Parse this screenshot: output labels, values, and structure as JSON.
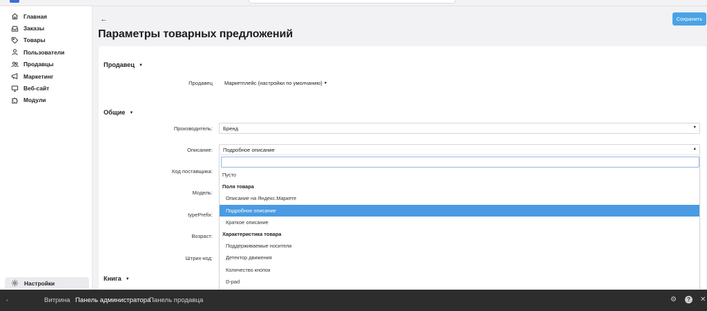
{
  "sidebar": {
    "items": [
      {
        "label": "Главная",
        "icon": "home-icon"
      },
      {
        "label": "Заказы",
        "icon": "inbox-icon"
      },
      {
        "label": "Товары",
        "icon": "tag-icon"
      },
      {
        "label": "Пользователи",
        "icon": "user-icon"
      },
      {
        "label": "Продавцы",
        "icon": "users-icon"
      },
      {
        "label": "Маркетинг",
        "icon": "megaphone-icon"
      },
      {
        "label": "Веб-сайт",
        "icon": "monitor-icon"
      },
      {
        "label": "Модули",
        "icon": "puzzle-icon"
      }
    ],
    "settings_label": "Настройки"
  },
  "header": {
    "back": "←",
    "title": "Параметры товарных предложений",
    "save_label": "Сохранить"
  },
  "sections": {
    "seller_title": "Продавец",
    "seller_label": "Продавец",
    "seller_value": "Маркетплейс (настройки по умолчанию)",
    "general_title": "Общие",
    "book_title": "Книга"
  },
  "fields": {
    "manufacturer_label": "Производитель:",
    "manufacturer_value": "Бренд",
    "description_label": "Описание:",
    "description_value": "Подробное описание",
    "supplier_code_label": "Код поставщика:",
    "model_label": "Модель:",
    "type_prefix_label": "typePrefix:",
    "age_label": "Возраст:",
    "barcode_label": "Штрих-код:"
  },
  "dropdown": {
    "search_value": "",
    "items": [
      {
        "label": "Пусто",
        "type": "option",
        "indent": false,
        "selected": false
      },
      {
        "label": "Поля товара",
        "type": "group",
        "indent": false,
        "selected": false
      },
      {
        "label": "Описание на Яндекс.Маркете",
        "type": "option",
        "indent": true,
        "selected": false
      },
      {
        "label": "Подробное описание",
        "type": "option",
        "indent": true,
        "selected": true
      },
      {
        "label": "Краткое описание",
        "type": "option",
        "indent": true,
        "selected": false
      },
      {
        "label": "Характеристика товара",
        "type": "group",
        "indent": false,
        "selected": false
      },
      {
        "label": "Поддерживаемые носители",
        "type": "option",
        "indent": true,
        "selected": false
      },
      {
        "label": "Детектор движения",
        "type": "option",
        "indent": true,
        "selected": false
      },
      {
        "label": "Количество кнопок",
        "type": "option",
        "indent": true,
        "selected": false
      },
      {
        "label": "D-pad",
        "type": "option",
        "indent": true,
        "selected": false
      }
    ]
  },
  "bottombar": {
    "links": [
      {
        "label": "Витрина",
        "active": false
      },
      {
        "label": "Панель администратора",
        "active": true
      },
      {
        "label": "Панель продавца",
        "active": false
      }
    ],
    "icons": [
      "gear-icon",
      "help-icon",
      "close-icon"
    ]
  },
  "colors": {
    "accent": "#4a9be3",
    "save_button": "#4aa3e6",
    "bottombar_bg": "#2d2d2d"
  }
}
